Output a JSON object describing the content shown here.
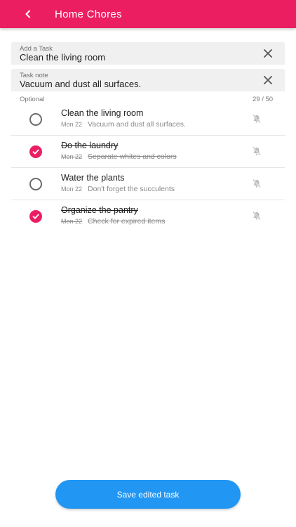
{
  "appbar": {
    "title": "Home Chores",
    "color": "#EC1E62"
  },
  "task_field": {
    "label": "Add a Task",
    "value": "Clean the living room"
  },
  "note_field": {
    "label": "Task note",
    "value": "Vacuum and dust all surfaces."
  },
  "helper": {
    "optional": "Optional",
    "counter": "29 / 50"
  },
  "tasks": [
    {
      "title": "Clean the living room",
      "date": "Mon 22",
      "note": "Vacuum and dust all surfaces.",
      "done": false
    },
    {
      "title": "Do the laundry",
      "date": "Mon 22",
      "note": "Separate whites and colors",
      "done": true
    },
    {
      "title": "Water the plants",
      "date": "Mon 22",
      "note": "Don't forget the succulents",
      "done": false
    },
    {
      "title": "Organize the pantry",
      "date": "Mon 22",
      "note": "Check for expired items",
      "done": true
    }
  ],
  "save_button": {
    "label": "Save edited task",
    "color": "#2196F3"
  }
}
